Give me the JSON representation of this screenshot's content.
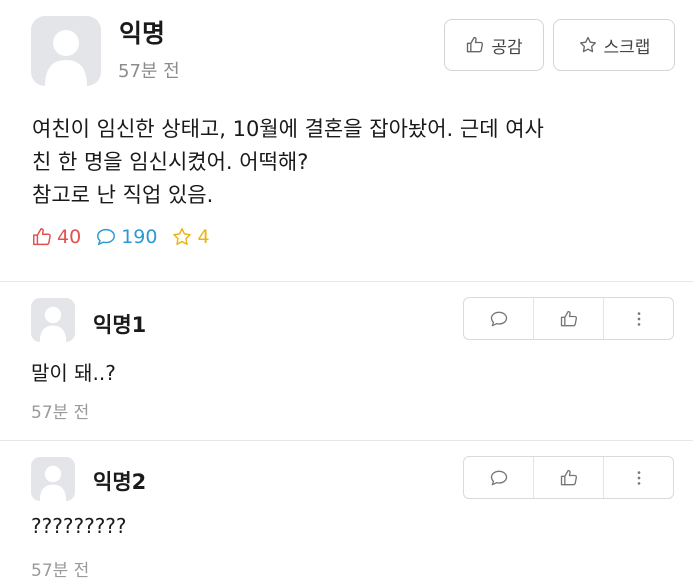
{
  "post": {
    "author": "익명",
    "time": "57분 전",
    "body": "여친이 임신한 상태고, 10월에 결혼을 잡아놨어. 근데 여사\n친 한 명을 임신시켰어.  어떡해?\n참고로 난 직업 있음.",
    "like_label": "공감",
    "scrap_label": "스크랩",
    "stats": {
      "likes": "40",
      "comments": "190",
      "scraps": "4"
    }
  },
  "comments": [
    {
      "author": "익명1",
      "body": "말이 돼..?",
      "time": "57분 전"
    },
    {
      "author": "익명2",
      "body": "?????????",
      "time": "57분 전"
    }
  ],
  "colors": {
    "like": "#e0524f",
    "comment": "#2b9ad2",
    "scrap": "#e8b516",
    "avatar_bg": "#e3e5e8"
  },
  "icons": [
    "thumbs-up-icon",
    "star-icon",
    "speech-bubble-icon",
    "more-vertical-icon"
  ]
}
